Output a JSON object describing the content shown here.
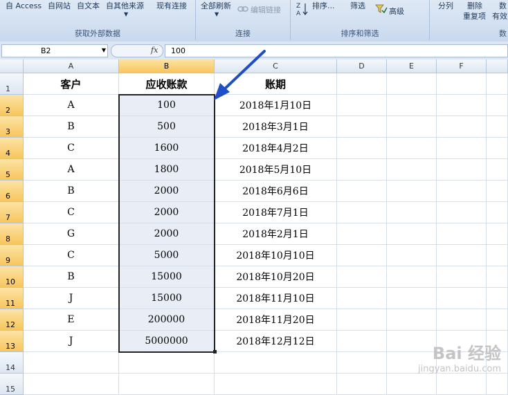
{
  "ribbon": {
    "external_data": {
      "access": "自 Access",
      "web": "自网站",
      "text": "自文本",
      "other": "自其他来源",
      "existing": "现有连接",
      "label": "获取外部数据"
    },
    "connections": {
      "refresh_all": "全部刷新",
      "edit_links": "编辑链接",
      "label": "连接"
    },
    "sort_filter": {
      "sort": "排序...",
      "filter": "筛选",
      "advanced": "高级",
      "label": "排序和筛选"
    },
    "data_tools": {
      "split": "分列",
      "remove_dup_1": "删除",
      "remove_dup_2": "重复项",
      "valid_1": "数",
      "valid_2": "有效",
      "label": "数"
    }
  },
  "formula_bar": {
    "name_box": "B2",
    "fx": "fx",
    "content": "100"
  },
  "columns": [
    "A",
    "B",
    "C",
    "D",
    "E",
    "F"
  ],
  "rows": [
    "1",
    "2",
    "3",
    "4",
    "5",
    "6",
    "7",
    "8",
    "9",
    "10",
    "11",
    "12",
    "13",
    "14",
    "15"
  ],
  "header_row": {
    "a": "客户",
    "b": "应收账款",
    "c": "账期"
  },
  "data_rows": [
    {
      "a": "A",
      "b": "100",
      "c": "2018年1月10日"
    },
    {
      "a": "B",
      "b": "500",
      "c": "2018年3月1日"
    },
    {
      "a": "C",
      "b": "1600",
      "c": "2018年4月2日"
    },
    {
      "a": "A",
      "b": "1800",
      "c": "2018年5月10日"
    },
    {
      "a": "B",
      "b": "2000",
      "c": "2018年6月6日"
    },
    {
      "a": "C",
      "b": "2000",
      "c": "2018年7月1日"
    },
    {
      "a": "G",
      "b": "2000",
      "c": "2018年2月1日"
    },
    {
      "a": "C",
      "b": "5000",
      "c": "2018年10月10日"
    },
    {
      "a": "B",
      "b": "15000",
      "c": "2018年10月20日"
    },
    {
      "a": "J",
      "b": "15000",
      "c": "2018年11月10日"
    },
    {
      "a": "E",
      "b": "200000",
      "c": "2018年11月20日"
    },
    {
      "a": "J",
      "b": "5000000",
      "c": "2018年12月12日"
    }
  ],
  "watermark": {
    "line1": "Bai 经验",
    "line2": "jingyan.baidu.com"
  },
  "colors": {
    "arrow": "#1f4fc6",
    "selected_header": "#f8c65d",
    "selection_fill": "#e8edf6"
  }
}
